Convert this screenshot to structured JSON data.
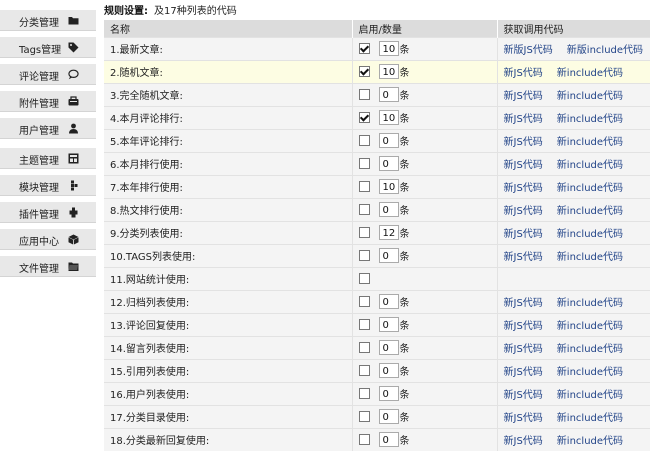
{
  "sidebar": {
    "items": [
      {
        "label": "分类管理",
        "icon": "folder-icon"
      },
      {
        "label": "Tags管理",
        "icon": "tag-icon"
      },
      {
        "label": "评论管理",
        "icon": "comment-icon"
      },
      {
        "label": "附件管理",
        "icon": "attachment-icon"
      },
      {
        "label": "用户管理",
        "icon": "user-icon"
      },
      {
        "label": "主题管理",
        "icon": "theme-icon"
      },
      {
        "label": "模块管理",
        "icon": "module-icon"
      },
      {
        "label": "插件管理",
        "icon": "plugin-icon"
      },
      {
        "label": "应用中心",
        "icon": "app-center-icon"
      },
      {
        "label": "文件管理",
        "icon": "file-folder-icon"
      }
    ]
  },
  "header": {
    "title": "规则设置:",
    "subtitle": "及17种列表的代码"
  },
  "table": {
    "columns": [
      "名称",
      "启用/数量",
      "获取调用代码"
    ],
    "unit": "条",
    "rows": [
      {
        "name": "1.最新文章:",
        "enabled": true,
        "count": "10",
        "js": "新版JS代码",
        "include": "新版include代码"
      },
      {
        "name": "2.随机文章:",
        "enabled": true,
        "count": "10",
        "js": "新JS代码",
        "include": "新include代码"
      },
      {
        "name": "3.完全随机文章:",
        "enabled": false,
        "count": "0",
        "js": "新JS代码",
        "include": "新include代码"
      },
      {
        "name": "4.本月评论排行:",
        "enabled": true,
        "count": "10",
        "js": "新JS代码",
        "include": "新include代码"
      },
      {
        "name": "5.本年评论排行:",
        "enabled": false,
        "count": "0",
        "js": "新JS代码",
        "include": "新include代码"
      },
      {
        "name": "6.本月排行使用:",
        "enabled": false,
        "count": "0",
        "js": "新JS代码",
        "include": "新include代码"
      },
      {
        "name": "7.本年排行使用:",
        "enabled": false,
        "count": "10",
        "js": "新JS代码",
        "include": "新include代码"
      },
      {
        "name": "8.热文排行使用:",
        "enabled": false,
        "count": "0",
        "js": "新JS代码",
        "include": "新include代码"
      },
      {
        "name": "9.分类列表使用:",
        "enabled": false,
        "count": "12",
        "js": "新JS代码",
        "include": "新include代码"
      },
      {
        "name": "10.TAGS列表使用:",
        "enabled": false,
        "count": "0",
        "js": "新JS代码",
        "include": "新include代码"
      },
      {
        "name": "11.网站统计使用:",
        "enabled": false,
        "count": null,
        "js": null,
        "include": null
      },
      {
        "name": "12.归档列表使用:",
        "enabled": false,
        "count": "0",
        "js": "新JS代码",
        "include": "新include代码"
      },
      {
        "name": "13.评论回复使用:",
        "enabled": false,
        "count": "0",
        "js": "新JS代码",
        "include": "新include代码"
      },
      {
        "name": "14.留言列表使用:",
        "enabled": false,
        "count": "0",
        "js": "新JS代码",
        "include": "新include代码"
      },
      {
        "name": "15.引用列表使用:",
        "enabled": false,
        "count": "0",
        "js": "新JS代码",
        "include": "新include代码"
      },
      {
        "name": "16.用户列表使用:",
        "enabled": false,
        "count": "0",
        "js": "新JS代码",
        "include": "新include代码"
      },
      {
        "name": "17.分类目录使用:",
        "enabled": false,
        "count": "0",
        "js": "新JS代码",
        "include": "新include代码"
      },
      {
        "name": "18.分类最新回复使用:",
        "enabled": false,
        "count": "0",
        "js": "新JS代码",
        "include": "新include代码"
      }
    ]
  },
  "colors": {
    "sidebar_bg": "#e8e8e8",
    "header_bg": "#dcdcdc",
    "row_bg": "#f4f4f4",
    "highlight_row_bg": "#fdfde3",
    "link": "#224488"
  }
}
